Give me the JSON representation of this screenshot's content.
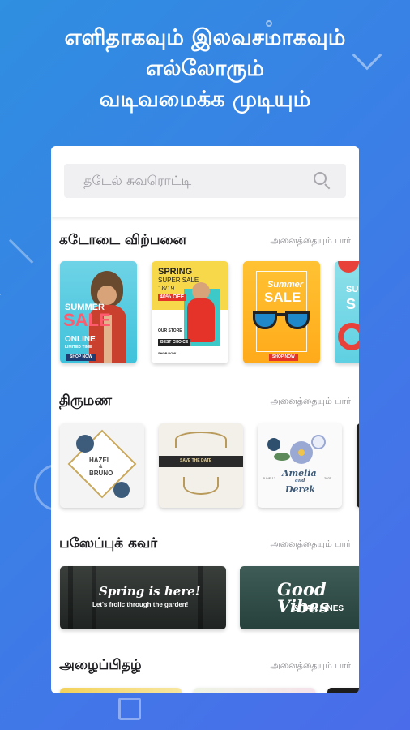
{
  "headline": {
    "line1": "எளிதாகவும் இலவசமாகவும்",
    "line2": "எல்லோரும்",
    "line3": "வடிவமைக்க முடியும்"
  },
  "search": {
    "placeholder": "தடேல் சுவரொட்டி",
    "icon": "search-icon"
  },
  "sections": [
    {
      "title": "கடோடை விற்பனை",
      "link": "அனைத்தையும் பார்",
      "thumbs": [
        {
          "line1": "SUMMER",
          "line2": "SALE",
          "line3": "ONLINE",
          "line4": "LIMITED TIME",
          "line5": "SHOP NOW"
        },
        {
          "line1": "SPRING",
          "line2": "SUPER SALE",
          "line3": "18/19",
          "line4": "40% OFF",
          "line5": "OUR STORE",
          "line6": "BEST CHOICE",
          "line7": "SHOP NOW"
        },
        {
          "line1": "Summer",
          "line2": "SALE",
          "line3": "SHOP NOW"
        },
        {
          "line1": "SU",
          "line2": "S"
        }
      ]
    },
    {
      "title": "திருமண",
      "link": "அனைத்தையும் பார்",
      "thumbs": [
        {
          "line1": "HAZEL",
          "line2": "&",
          "line3": "BRUNO"
        },
        {
          "line1": "SAVE THE DATE"
        },
        {
          "line1": "Amelia",
          "line2": "and",
          "line3": "Derek",
          "line4": "JUNE 17",
          "line5": "2025"
        }
      ]
    },
    {
      "title": "பஸேப்புக் கவர்",
      "link": "அனைத்தையும் பார்",
      "thumbs": [
        {
          "line1": "Spring is here!",
          "line2": "Let's frolic through the garden!"
        },
        {
          "line1": "Good Vibes",
          "line2": "& TAN LINES"
        }
      ]
    },
    {
      "title": "அழைப்பிதழ்",
      "link": "அனைத்தையும் பார்"
    }
  ]
}
